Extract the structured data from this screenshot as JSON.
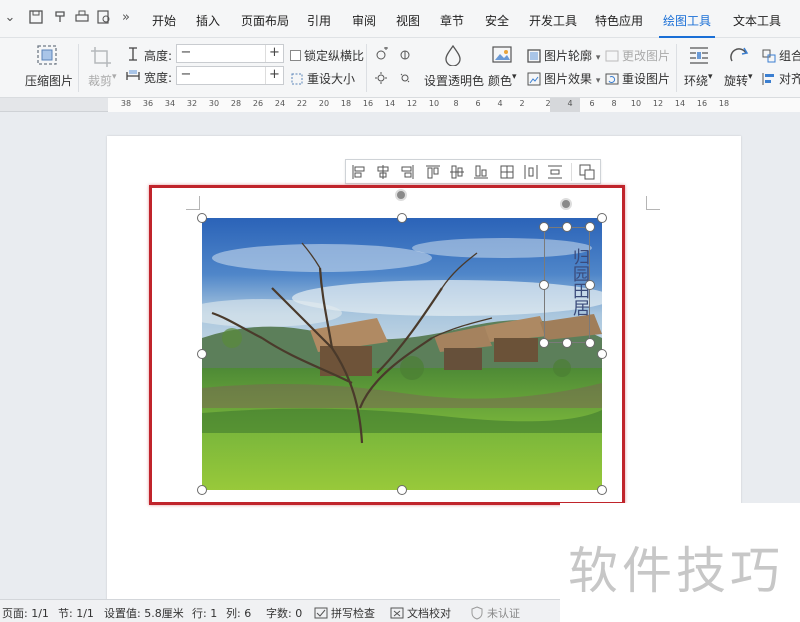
{
  "menubar": {
    "tabs": [
      "开始",
      "插入",
      "页面布局",
      "引用",
      "审阅",
      "视图",
      "章节",
      "安全",
      "开发工具",
      "特色应用",
      "绘图工具",
      "文本工具"
    ],
    "overflow_glyph": "»"
  },
  "ribbon": {
    "compress_label": "压缩图片",
    "crop_label": "裁剪",
    "height_label": "高度:",
    "width_label": "宽度:",
    "height_value": "",
    "width_value": "",
    "minus": "−",
    "plus": "+",
    "lock_ratio_label": "锁定纵横比",
    "reset_size_label": "重设大小",
    "transparent_label": "设置透明色",
    "color_label": "颜色",
    "outline_label": "图片轮廓",
    "effect_label": "图片效果",
    "change_pic_label": "更改图片",
    "reset_pic_label": "重设图片",
    "wrap_label": "环绕",
    "rotate_label": "旋转",
    "group_label": "组合",
    "align_label": "对齐",
    "dropdown_glyph": "▾"
  },
  "ruler": {
    "numbers": [
      "38",
      "36",
      "34",
      "32",
      "30",
      "28",
      "26",
      "24",
      "22",
      "20",
      "18",
      "16",
      "14",
      "12",
      "10",
      "8",
      "6",
      "4",
      "2",
      "2",
      "4",
      "6",
      "8",
      "10",
      "12",
      "14",
      "16",
      "18"
    ]
  },
  "textbox": {
    "text": "归园田居"
  },
  "statusbar": {
    "page": "页面: 1/1",
    "section": "节: 1/1",
    "setting": "设置值: 5.8厘米",
    "row": "行: 1",
    "col": "列: 6",
    "words": "字数: 0",
    "spell": "拼写检查",
    "proof": "文档校对",
    "auth": "未认证"
  },
  "watermark": {
    "text": "软件技巧"
  },
  "colors": {
    "accent": "#1a6fd6",
    "selection_red": "#c0242b"
  }
}
